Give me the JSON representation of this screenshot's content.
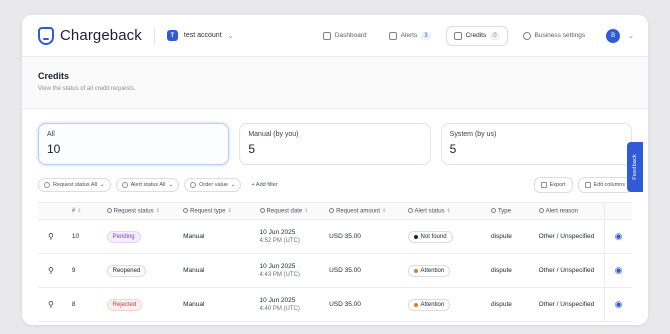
{
  "app": {
    "name": "Chargeback",
    "account": "test account",
    "account_initial": "T",
    "user_initial": "B"
  },
  "nav": {
    "items": [
      {
        "label": "Dashboard",
        "icon": "home-icon"
      },
      {
        "label": "Alerts",
        "icon": "bell-icon",
        "count": "3"
      },
      {
        "label": "Credits",
        "icon": "receipt-icon",
        "count": "0"
      },
      {
        "label": "Business settings",
        "icon": "gear-icon"
      }
    ]
  },
  "page": {
    "title": "Credits",
    "subtitle": "View the status of all credit requests."
  },
  "cards": [
    {
      "label": "All",
      "value": "10"
    },
    {
      "label": "Manual (by you)",
      "value": "5"
    },
    {
      "label": "System (by us)",
      "value": "5"
    }
  ],
  "filters": {
    "request_status": "Request status All",
    "alert_status": "Alert status All",
    "order_value": "Order value",
    "add_filter": "+ Add filter",
    "export": "Export",
    "edit_columns": "Edit columns"
  },
  "table": {
    "headers": [
      "#",
      "Request status",
      "Request type",
      "Request date",
      "Request amount",
      "Alert status",
      "Type",
      "Alert reason"
    ],
    "rows": [
      {
        "id": "10",
        "status": "Pending",
        "type": "Manual",
        "date": "10 Jun 2025",
        "time": "4:52 PM (UTC)",
        "amount": "USD 35.00",
        "alert_status": "Not found",
        "kind": "dispute",
        "reason": "Other / Unspecified"
      },
      {
        "id": "9",
        "status": "Reopened",
        "type": "Manual",
        "date": "10 Jun 2025",
        "time": "4:43 PM (UTC)",
        "amount": "USD 35.00",
        "alert_status": "Attention",
        "kind": "dispute",
        "reason": "Other / Unspecified"
      },
      {
        "id": "8",
        "status": "Rejected",
        "type": "Manual",
        "date": "10 Jun 2025",
        "time": "4:40 PM (UTC)",
        "amount": "USD 35.00",
        "alert_status": "Attention",
        "kind": "dispute",
        "reason": "Other / Unspecified"
      }
    ]
  },
  "colors": {
    "accent": "#2f5bd8",
    "pending": "#7a3fd6",
    "rejected": "#d93a3a",
    "attention": "#e07a2a",
    "not_found": "#1f2430"
  },
  "feedback": "Feedback"
}
